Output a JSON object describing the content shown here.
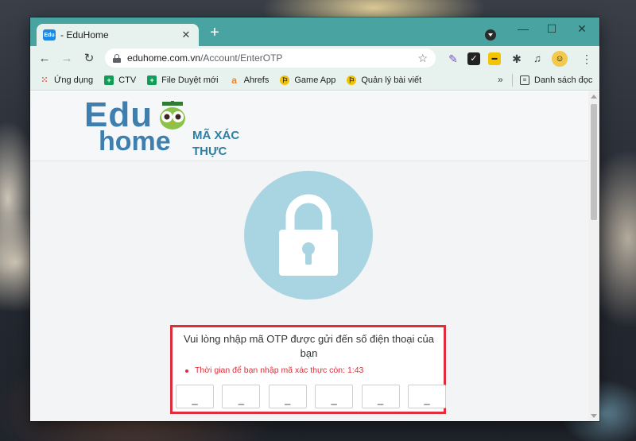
{
  "browser": {
    "tab_title": "- EduHome",
    "tab_favicon_text": "Edu",
    "url_host": "eduhome.com.vn",
    "url_path": "/Account/EnterOTP",
    "nav": {
      "back": "←",
      "forward": "→",
      "reload": "↻"
    },
    "window_controls": {
      "minimize": "—",
      "maximize": "☐",
      "close": "✕"
    },
    "bookmarks": [
      {
        "label": "Ứng dụng",
        "icon": "apps-grid-icon",
        "color": "#e8453c"
      },
      {
        "label": "CTV",
        "icon": "sheets-icon",
        "color": "#0f9d58"
      },
      {
        "label": "File Duyệt mới",
        "icon": "sheets-icon",
        "color": "#0f9d58"
      },
      {
        "label": "Ahrefs",
        "icon": "ahrefs-icon",
        "color": "#f48120"
      },
      {
        "label": "Game App",
        "icon": "runner-icon",
        "color": "#f2c200"
      },
      {
        "label": "Quản lý bài viết",
        "icon": "runner-icon",
        "color": "#f2c200"
      }
    ],
    "bookmarks_more": "»",
    "reading_list": "Danh sách đọc"
  },
  "page": {
    "logo_edu": "Edu",
    "logo_home": "home",
    "title": "MÃ XÁC THỰC",
    "otp": {
      "message": "Vui lòng nhập mã OTP được gửi đến số điện thoại của bạn",
      "timer_label": "Thời gian để bạn nhập mã xác thực còn: 1:43",
      "inputs": [
        "_",
        "_",
        "_",
        "_",
        "_",
        "_"
      ]
    }
  },
  "colors": {
    "titlebar": "#49a3a0",
    "toolbar": "#e7f1ee",
    "brand": "#3e7fb0",
    "lock_circle": "#a9d4e2",
    "alert_red": "#e02d39"
  }
}
